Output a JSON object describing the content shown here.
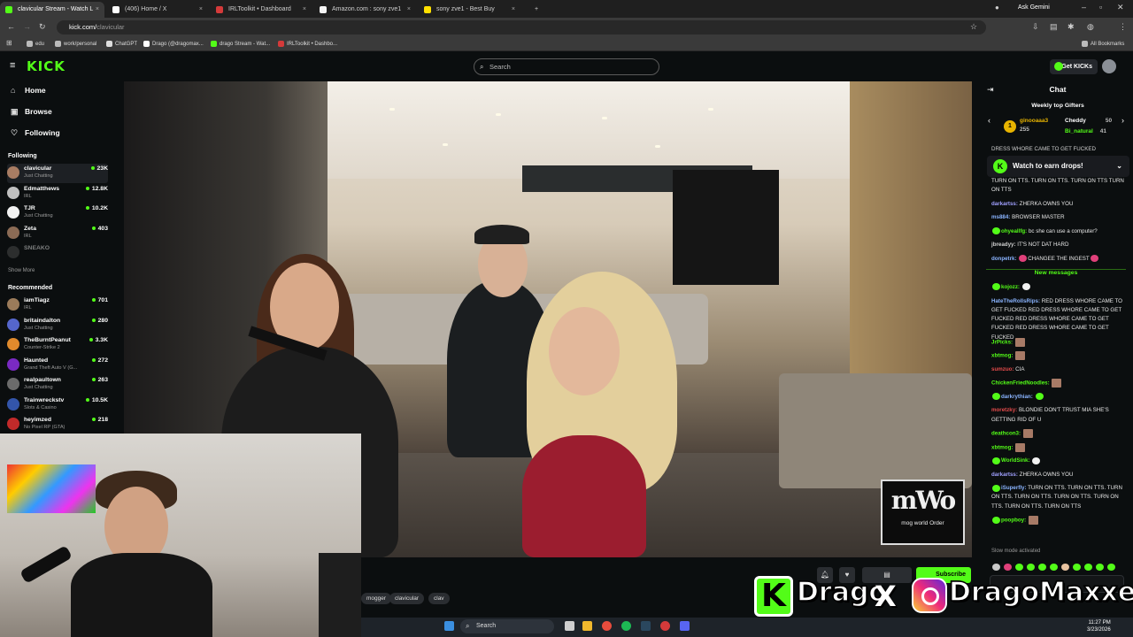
{
  "browser": {
    "tabs": [
      {
        "title": "clavicular Stream - Watch L",
        "active": true,
        "color": "#53fc18"
      },
      {
        "title": "(406) Home / X",
        "active": false,
        "color": "#ffffff"
      },
      {
        "title": "IRLToolkit • Dashboard",
        "active": false,
        "color": "#d43a3a"
      },
      {
        "title": "Amazon.com : sony zve1",
        "active": false,
        "color": "#f5f5f5"
      },
      {
        "title": "sony zve1 - Best Buy",
        "active": false,
        "color": "#ffe000"
      }
    ],
    "new_tab": "+",
    "url_host": "kick.com/",
    "url_path": "clavicular",
    "ask_gemini": "Ask Gemini",
    "bookmarks": [
      {
        "label": "edu",
        "color": "#bbbbbb"
      },
      {
        "label": "work/personal",
        "color": "#bbbbbb"
      },
      {
        "label": "ChatGPT",
        "color": "#dddddd"
      },
      {
        "label": "Drago (@dragomax...",
        "color": "#ffffff"
      },
      {
        "label": "drago Stream - Wat...",
        "color": "#53fc18"
      },
      {
        "label": "IRLToolkit • Dashbo...",
        "color": "#d43a3a"
      }
    ],
    "all_bookmarks": "All Bookmarks"
  },
  "header": {
    "logo": "KICK",
    "search_placeholder": "Search",
    "get_kicks": "Get KICKs"
  },
  "sidebar": {
    "nav": [
      {
        "label": "Home",
        "icon": "home-icon",
        "glyph": "⌂"
      },
      {
        "label": "Browse",
        "icon": "browse-icon",
        "glyph": "▣"
      },
      {
        "label": "Following",
        "icon": "heart-icon",
        "glyph": "♡"
      }
    ],
    "following_title": "Following",
    "following": [
      {
        "name": "clavicular",
        "game": "Just Chatting",
        "viewers": "23K",
        "color": "#a97d63"
      },
      {
        "name": "Edmatthews",
        "game": "IRL",
        "viewers": "12.8K",
        "color": "#c0c0c0"
      },
      {
        "name": "TJR",
        "game": "Just Chatting",
        "viewers": "10.2K",
        "color": "#f2f2f2"
      },
      {
        "name": "Zeta",
        "game": "IRL",
        "viewers": "403",
        "color": "#8b6b55"
      },
      {
        "name": "SNEAKO",
        "game": "",
        "viewers": "",
        "color": "#555555"
      }
    ],
    "show_more": "Show More",
    "recommended_title": "Recommended",
    "recommended": [
      {
        "name": "iamTiagz",
        "game": "IRL",
        "viewers": "701",
        "color": "#9b7b5a"
      },
      {
        "name": "britaindalton",
        "game": "Just Chatting",
        "viewers": "280",
        "color": "#5566cc"
      },
      {
        "name": "TheBurntPeanut",
        "game": "Counter-Strike 2",
        "viewers": "3.3K",
        "color": "#e08a2c"
      },
      {
        "name": "Haunted",
        "game": "Grand Theft Auto V (G...",
        "viewers": "272",
        "color": "#7a2ac2"
      },
      {
        "name": "realpaultown",
        "game": "Just Chatting",
        "viewers": "263",
        "color": "#6b6b6b"
      },
      {
        "name": "Trainwreckstv",
        "game": "Slots & Casino",
        "viewers": "10.5K",
        "color": "#3355aa"
      },
      {
        "name": "heyimzed",
        "game": "No Pixel RP (GTA)",
        "viewers": "218",
        "color": "#c22a2a"
      }
    ]
  },
  "video": {
    "watermark_big": "mWo",
    "watermark_small": "mog world Order"
  },
  "below_video": {
    "tags": [
      "mogger",
      "clavicular",
      "clav"
    ],
    "subscribe": "Subscribe"
  },
  "chat": {
    "title": "Chat",
    "gifters_title": "Weekly top Gifters",
    "gifters": [
      {
        "name": "ginooaaa3",
        "count": "255",
        "color": "#e8b400"
      },
      {
        "name": "Cheddy",
        "count": "50",
        "color": "#ffffff"
      },
      {
        "name": "Bi_natural",
        "count": "41",
        "color": "#53fc18"
      }
    ],
    "drops": "Watch to earn drops!",
    "truncated_top": "DRESS WHORE CAME TO GET FUCKED",
    "messages_top": [
      {
        "user": "",
        "text": "TURN ON TTS. TURN ON TTS. TURN ON TTS TURN ON TTS",
        "color": "#53fc18",
        "emotes": ""
      },
      {
        "user": "darkartss:",
        "text": "ZHERKA OWNS YOU",
        "color": "#a0a0ff",
        "emotes": ""
      },
      {
        "user": "ms884:",
        "text": "BROWSER MASTER",
        "color": "#8ab4ff",
        "emotes": ""
      },
      {
        "user": "ohyeallfg:",
        "text": "bc she can use a computer?",
        "color": "#53fc18",
        "emotes": "badge"
      },
      {
        "user": "jbreadyy:",
        "text": "IT'S NOT DAT HARD",
        "color": "#d0d0d0",
        "emotes": ""
      },
      {
        "user": "donpetrk:",
        "text": "CHANGEE THE INGEST",
        "color": "#8ab4ff",
        "emotes": "pink"
      }
    ],
    "new_messages": "New messages",
    "messages": [
      {
        "user": "kojozz:",
        "text": "",
        "color": "#53fc18",
        "emotes": "badge-white"
      },
      {
        "user": "HateTheRollsRips:",
        "text": "RED DRESS WHORE CAME TO GET FUCKED RED DRESS WHORE CAME TO GET FUCKED RED DRESS WHORE CAME TO GET FUCKED RED DRESS WHORE CAME TO GET FUCKED",
        "color": "#8ab4ff",
        "emotes": ""
      },
      {
        "user": "JrPicks:",
        "text": "",
        "color": "#53fc18",
        "emotes": "img"
      },
      {
        "user": "xbtmog:",
        "text": "",
        "color": "#53fc18",
        "emotes": "img"
      },
      {
        "user": "sumzuo:",
        "text": "CIA",
        "color": "#e44b4b",
        "emotes": ""
      },
      {
        "user": "ChickenFriedNoodles:",
        "text": "",
        "color": "#53fc18",
        "emotes": "img"
      },
      {
        "user": "darkrythian:",
        "text": "",
        "color": "#8ab4ff",
        "emotes": "badge-green"
      },
      {
        "user": "moretzky:",
        "text": "BLONDIE DON'T TRUST MIA SHE'S GETTING RID OF U",
        "color": "#e44b4b",
        "emotes": ""
      },
      {
        "user": "deathcon3:",
        "text": "",
        "color": "#53fc18",
        "emotes": "img"
      },
      {
        "user": "xbtmog:",
        "text": "",
        "color": "#53fc18",
        "emotes": "img"
      },
      {
        "user": "WorldSink:",
        "text": "",
        "color": "#53fc18",
        "emotes": "badge-white"
      },
      {
        "user": "darkartss:",
        "text": "ZHERKA OWNS YOU",
        "color": "#a0a0ff",
        "emotes": ""
      },
      {
        "user": "iSuperfly:",
        "text": "TURN ON TTS. TURN ON TTS. TURN ON TTS. TURN ON TTS. TURN ON TTS. TURN ON TTS. TURN ON TTS. TURN ON TTS",
        "color": "#8ab4ff",
        "emotes": "badge"
      },
      {
        "user": "poopboy:",
        "text": "",
        "color": "#53fc18",
        "emotes": "badge-img"
      }
    ],
    "slow_mode": "Slow mode activated"
  },
  "brand_overlay": {
    "k": "K",
    "name1": "Drago",
    "x": "X",
    "name2": "DragoMaxxer"
  },
  "taskbar": {
    "search": "Search",
    "time": "11:27 PM",
    "date": "3/23/2026"
  }
}
